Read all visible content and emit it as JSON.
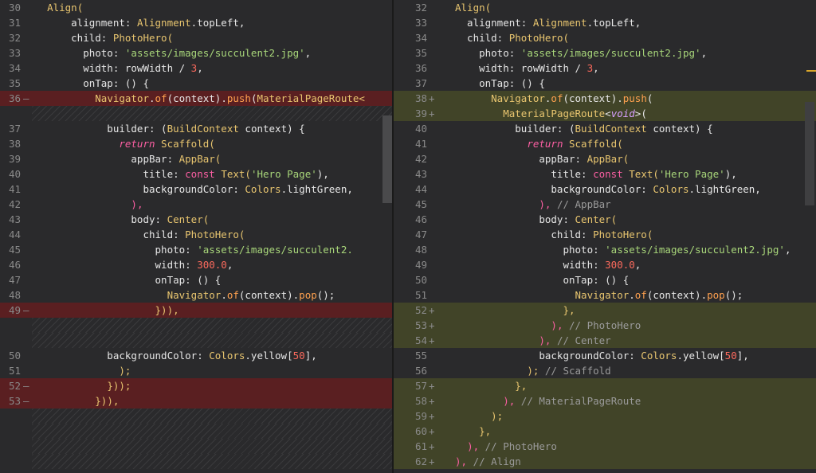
{
  "colors": {
    "background": "#2a2a2c",
    "deleted_line": "#5a1f21",
    "added_line": "#414428",
    "keyword": "#fc5fa3",
    "type": "#e8c56f",
    "function": "#ffa14f",
    "string": "#a8d67a",
    "number": "#fc6a5d",
    "comment": "#9a9a9a"
  },
  "left_pane": [
    {
      "kind": "ctx",
      "num": "30",
      "mark": "",
      "code": [
        {
          "t": "  "
        },
        {
          "t": "Align(",
          "c": "t"
        }
      ]
    },
    {
      "kind": "ctx",
      "num": "31",
      "mark": "",
      "code": [
        {
          "t": "      alignment: "
        },
        {
          "t": "Alignment",
          "c": "t"
        },
        {
          "t": ".topLeft,"
        }
      ]
    },
    {
      "kind": "ctx",
      "num": "32",
      "mark": "",
      "code": [
        {
          "t": "      child: "
        },
        {
          "t": "PhotoHero(",
          "c": "t"
        }
      ]
    },
    {
      "kind": "ctx",
      "num": "33",
      "mark": "",
      "code": [
        {
          "t": "        photo: "
        },
        {
          "t": "'assets/images/succulent2.jpg'",
          "c": "s"
        },
        {
          "t": ","
        }
      ]
    },
    {
      "kind": "ctx",
      "num": "34",
      "mark": "",
      "code": [
        {
          "t": "        width: rowWidth / "
        },
        {
          "t": "3",
          "c": "n"
        },
        {
          "t": ","
        }
      ]
    },
    {
      "kind": "ctx",
      "num": "35",
      "mark": "",
      "code": [
        {
          "t": "        onTap: () {"
        }
      ]
    },
    {
      "kind": "del",
      "num": "36",
      "mark": "—",
      "code": [
        {
          "t": "          "
        },
        {
          "t": "Navigator",
          "c": "t"
        },
        {
          "t": "."
        },
        {
          "t": "of",
          "c": "f"
        },
        {
          "t": "(context)."
        },
        {
          "t": "push",
          "c": "f"
        },
        {
          "t": "("
        },
        {
          "t": "MaterialPageRoute<",
          "c": "t"
        }
      ]
    },
    {
      "kind": "filler"
    },
    {
      "kind": "ctx",
      "num": "37",
      "mark": "",
      "code": [
        {
          "t": "            builder: ("
        },
        {
          "t": "BuildContext",
          "c": "t"
        },
        {
          "t": " context) {"
        }
      ]
    },
    {
      "kind": "ctx",
      "num": "38",
      "mark": "",
      "code": [
        {
          "t": "              "
        },
        {
          "t": "return",
          "c": "kw"
        },
        {
          "t": " "
        },
        {
          "t": "Scaffold(",
          "c": "t"
        }
      ]
    },
    {
      "kind": "ctx",
      "num": "39",
      "mark": "",
      "code": [
        {
          "t": "                appBar: "
        },
        {
          "t": "AppBar(",
          "c": "t"
        }
      ]
    },
    {
      "kind": "ctx",
      "num": "40",
      "mark": "",
      "code": [
        {
          "t": "                  title: "
        },
        {
          "t": "const",
          "c": "k"
        },
        {
          "t": " "
        },
        {
          "t": "Text(",
          "c": "t"
        },
        {
          "t": "'Hero Page'",
          "c": "s"
        },
        {
          "t": "),"
        }
      ]
    },
    {
      "kind": "ctx",
      "num": "41",
      "mark": "",
      "code": [
        {
          "t": "                  backgroundColor: "
        },
        {
          "t": "Colors",
          "c": "t"
        },
        {
          "t": ".lightGreen,"
        }
      ]
    },
    {
      "kind": "ctx",
      "num": "42",
      "mark": "",
      "code": [
        {
          "t": "                "
        },
        {
          "t": "),",
          "c": "k"
        }
      ]
    },
    {
      "kind": "ctx",
      "num": "43",
      "mark": "",
      "code": [
        {
          "t": "                body: "
        },
        {
          "t": "Center(",
          "c": "t"
        }
      ]
    },
    {
      "kind": "ctx",
      "num": "44",
      "mark": "",
      "code": [
        {
          "t": "                  child: "
        },
        {
          "t": "PhotoHero(",
          "c": "t"
        }
      ]
    },
    {
      "kind": "ctx",
      "num": "45",
      "mark": "",
      "code": [
        {
          "t": "                    photo: "
        },
        {
          "t": "'assets/images/succulent2.",
          "c": "s"
        }
      ]
    },
    {
      "kind": "ctx",
      "num": "46",
      "mark": "",
      "code": [
        {
          "t": "                    width: "
        },
        {
          "t": "300.0",
          "c": "n"
        },
        {
          "t": ","
        }
      ]
    },
    {
      "kind": "ctx",
      "num": "47",
      "mark": "",
      "code": [
        {
          "t": "                    onTap: () {"
        }
      ]
    },
    {
      "kind": "ctx",
      "num": "48",
      "mark": "",
      "code": [
        {
          "t": "                      "
        },
        {
          "t": "Navigator",
          "c": "t"
        },
        {
          "t": "."
        },
        {
          "t": "of",
          "c": "f"
        },
        {
          "t": "(context)."
        },
        {
          "t": "pop",
          "c": "f"
        },
        {
          "t": "();"
        }
      ]
    },
    {
      "kind": "del",
      "num": "49",
      "mark": "—",
      "code": [
        {
          "t": "                    "
        },
        {
          "t": "})),",
          "c": "t"
        }
      ]
    },
    {
      "kind": "filler"
    },
    {
      "kind": "filler"
    },
    {
      "kind": "ctx",
      "num": "50",
      "mark": "",
      "code": [
        {
          "t": "            backgroundColor: "
        },
        {
          "t": "Colors",
          "c": "t"
        },
        {
          "t": ".yellow["
        },
        {
          "t": "50",
          "c": "n"
        },
        {
          "t": "],"
        }
      ]
    },
    {
      "kind": "ctx",
      "num": "51",
      "mark": "",
      "code": [
        {
          "t": "              "
        },
        {
          "t": ");",
          "c": "t"
        }
      ]
    },
    {
      "kind": "del",
      "num": "52",
      "mark": "—",
      "code": [
        {
          "t": "            "
        },
        {
          "t": "}));",
          "c": "t"
        }
      ]
    },
    {
      "kind": "del",
      "num": "53",
      "mark": "—",
      "code": [
        {
          "t": "          "
        },
        {
          "t": "})),",
          "c": "t"
        }
      ]
    },
    {
      "kind": "filler"
    },
    {
      "kind": "filler"
    },
    {
      "kind": "filler"
    },
    {
      "kind": "filler"
    }
  ],
  "right_pane": [
    {
      "kind": "ctx",
      "num": "32",
      "mark": "",
      "code": [
        {
          "t": "Align(",
          "c": "t"
        }
      ]
    },
    {
      "kind": "ctx",
      "num": "33",
      "mark": "",
      "code": [
        {
          "t": "  alignment: "
        },
        {
          "t": "Alignment",
          "c": "t"
        },
        {
          "t": ".topLeft,"
        }
      ]
    },
    {
      "kind": "ctx",
      "num": "34",
      "mark": "",
      "code": [
        {
          "t": "  child: "
        },
        {
          "t": "PhotoHero(",
          "c": "t"
        }
      ]
    },
    {
      "kind": "ctx",
      "num": "35",
      "mark": "",
      "code": [
        {
          "t": "    photo: "
        },
        {
          "t": "'assets/images/succulent2.jpg'",
          "c": "s"
        },
        {
          "t": ","
        }
      ]
    },
    {
      "kind": "ctx",
      "num": "36",
      "mark": "",
      "code": [
        {
          "t": "    width: rowWidth / "
        },
        {
          "t": "3",
          "c": "n"
        },
        {
          "t": ","
        }
      ]
    },
    {
      "kind": "ctx",
      "num": "37",
      "mark": "",
      "code": [
        {
          "t": "    onTap: () {"
        }
      ]
    },
    {
      "kind": "add",
      "num": "38",
      "mark": "+",
      "code": [
        {
          "t": "      "
        },
        {
          "t": "Navigator",
          "c": "t"
        },
        {
          "t": "."
        },
        {
          "t": "of",
          "c": "f"
        },
        {
          "t": "(context)."
        },
        {
          "t": "push",
          "c": "f"
        },
        {
          "t": "("
        }
      ]
    },
    {
      "kind": "add",
      "num": "39",
      "mark": "+",
      "code": [
        {
          "t": "        "
        },
        {
          "t": "MaterialPageRoute",
          "c": "t"
        },
        {
          "t": "<"
        },
        {
          "t": "void",
          "c": "i"
        },
        {
          "t": ">("
        }
      ]
    },
    {
      "kind": "ctx",
      "num": "40",
      "mark": "",
      "code": [
        {
          "t": "          builder: ("
        },
        {
          "t": "BuildContext",
          "c": "t"
        },
        {
          "t": " context) {"
        }
      ]
    },
    {
      "kind": "ctx",
      "num": "41",
      "mark": "",
      "code": [
        {
          "t": "            "
        },
        {
          "t": "return",
          "c": "kw"
        },
        {
          "t": " "
        },
        {
          "t": "Scaffold(",
          "c": "t"
        }
      ]
    },
    {
      "kind": "ctx",
      "num": "42",
      "mark": "",
      "code": [
        {
          "t": "              appBar: "
        },
        {
          "t": "AppBar(",
          "c": "t"
        }
      ]
    },
    {
      "kind": "ctx",
      "num": "43",
      "mark": "",
      "code": [
        {
          "t": "                title: "
        },
        {
          "t": "const",
          "c": "k"
        },
        {
          "t": " "
        },
        {
          "t": "Text(",
          "c": "t"
        },
        {
          "t": "'Hero Page'",
          "c": "s"
        },
        {
          "t": "),"
        }
      ]
    },
    {
      "kind": "ctx",
      "num": "44",
      "mark": "",
      "code": [
        {
          "t": "                backgroundColor: "
        },
        {
          "t": "Colors",
          "c": "t"
        },
        {
          "t": ".lightGreen,"
        }
      ]
    },
    {
      "kind": "ctx",
      "num": "45",
      "mark": "",
      "code": [
        {
          "t": "              "
        },
        {
          "t": "),",
          "c": "k"
        },
        {
          "t": " // AppBar",
          "c": "c"
        }
      ]
    },
    {
      "kind": "ctx",
      "num": "46",
      "mark": "",
      "code": [
        {
          "t": "              body: "
        },
        {
          "t": "Center(",
          "c": "t"
        }
      ]
    },
    {
      "kind": "ctx",
      "num": "47",
      "mark": "",
      "code": [
        {
          "t": "                child: "
        },
        {
          "t": "PhotoHero(",
          "c": "t"
        }
      ]
    },
    {
      "kind": "ctx",
      "num": "48",
      "mark": "",
      "code": [
        {
          "t": "                  photo: "
        },
        {
          "t": "'assets/images/succulent2.jpg'",
          "c": "s"
        },
        {
          "t": ","
        }
      ]
    },
    {
      "kind": "ctx",
      "num": "49",
      "mark": "",
      "code": [
        {
          "t": "                  width: "
        },
        {
          "t": "300.0",
          "c": "n"
        },
        {
          "t": ","
        }
      ]
    },
    {
      "kind": "ctx",
      "num": "50",
      "mark": "",
      "code": [
        {
          "t": "                  onTap: () {"
        }
      ]
    },
    {
      "kind": "ctx",
      "num": "51",
      "mark": "",
      "code": [
        {
          "t": "                    "
        },
        {
          "t": "Navigator",
          "c": "t"
        },
        {
          "t": "."
        },
        {
          "t": "of",
          "c": "f"
        },
        {
          "t": "(context)."
        },
        {
          "t": "pop",
          "c": "f"
        },
        {
          "t": "();"
        }
      ]
    },
    {
      "kind": "add",
      "num": "52",
      "mark": "+",
      "code": [
        {
          "t": "                  "
        },
        {
          "t": "},",
          "c": "t"
        }
      ]
    },
    {
      "kind": "add",
      "num": "53",
      "mark": "+",
      "code": [
        {
          "t": "                "
        },
        {
          "t": "),",
          "c": "k"
        },
        {
          "t": " // PhotoHero",
          "c": "c"
        }
      ]
    },
    {
      "kind": "add",
      "num": "54",
      "mark": "+",
      "code": [
        {
          "t": "              "
        },
        {
          "t": "),",
          "c": "k"
        },
        {
          "t": " // Center",
          "c": "c"
        }
      ]
    },
    {
      "kind": "ctx",
      "num": "55",
      "mark": "",
      "code": [
        {
          "t": "              backgroundColor: "
        },
        {
          "t": "Colors",
          "c": "t"
        },
        {
          "t": ".yellow["
        },
        {
          "t": "50",
          "c": "n"
        },
        {
          "t": "],"
        }
      ]
    },
    {
      "kind": "ctx",
      "num": "56",
      "mark": "",
      "code": [
        {
          "t": "            "
        },
        {
          "t": ");",
          "c": "t"
        },
        {
          "t": " // Scaffold",
          "c": "c"
        }
      ]
    },
    {
      "kind": "add",
      "num": "57",
      "mark": "+",
      "code": [
        {
          "t": "          "
        },
        {
          "t": "},",
          "c": "t"
        }
      ]
    },
    {
      "kind": "add",
      "num": "58",
      "mark": "+",
      "code": [
        {
          "t": "        "
        },
        {
          "t": "),",
          "c": "k"
        },
        {
          "t": " // MaterialPageRoute",
          "c": "c"
        }
      ]
    },
    {
      "kind": "add",
      "num": "59",
      "mark": "+",
      "code": [
        {
          "t": "      "
        },
        {
          "t": ");",
          "c": "t"
        }
      ]
    },
    {
      "kind": "add",
      "num": "60",
      "mark": "+",
      "code": [
        {
          "t": "    "
        },
        {
          "t": "},",
          "c": "t"
        }
      ]
    },
    {
      "kind": "add",
      "num": "61",
      "mark": "+",
      "code": [
        {
          "t": "  "
        },
        {
          "t": "),",
          "c": "k"
        },
        {
          "t": " // PhotoHero",
          "c": "c"
        }
      ]
    },
    {
      "kind": "add",
      "num": "62",
      "mark": "+",
      "code": [
        {
          "t": "),",
          "c": "k"
        },
        {
          "t": " // Align",
          "c": "c"
        }
      ]
    }
  ]
}
